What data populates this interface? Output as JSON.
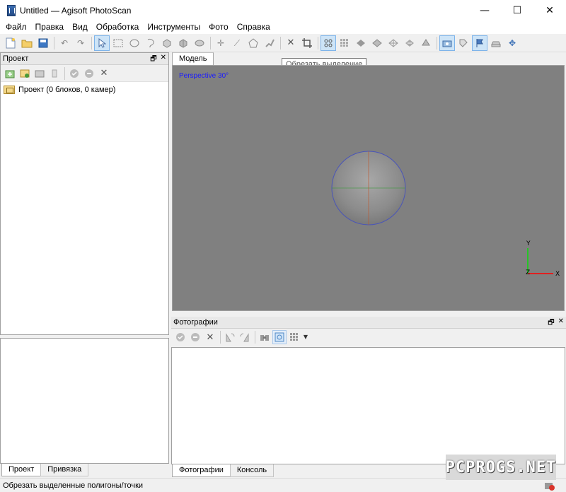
{
  "window": {
    "title": "Untitled — Agisoft PhotoScan",
    "controls": [
      "—",
      "☐",
      "✕"
    ]
  },
  "menu": [
    {
      "label": "Файл"
    },
    {
      "label": "Правка"
    },
    {
      "label": "Вид"
    },
    {
      "label": "Обработка"
    },
    {
      "label": "Инструменты"
    },
    {
      "label": "Фото"
    },
    {
      "label": "Справка"
    }
  ],
  "toolbar": {
    "icons": [
      "new-file",
      "open-folder",
      "save",
      "undo",
      "redo",
      "navigation",
      "rectangle-selection",
      "circle-selection",
      "free-form-selection",
      "resize-region",
      "move-region",
      "rotate-region",
      "ruler-point",
      "ruler",
      "draw-polygon",
      "draw-polyline",
      "delete-selection",
      "crop-selection",
      "point-cloud",
      "dense-cloud",
      "shaded-model",
      "solid-model",
      "wireframe-model",
      "textured-model",
      "tiled-model",
      "show-cameras",
      "show-markers",
      "show-shapes",
      "show-region",
      "reset-view"
    ],
    "active": [
      "navigation",
      "point-cloud",
      "show-cameras",
      "show-shapes"
    ],
    "tooltip": "Обрезать выделение"
  },
  "project_panel": {
    "title": "Проект",
    "tree_root": "Проект (0 блоков, 0 камер)",
    "toolbar_icons": [
      "add-chunk",
      "add-photos",
      "add-folder",
      "remove-item",
      "enable-item",
      "disable-item",
      "delete-item"
    ]
  },
  "left_tabs": [
    {
      "label": "Проект",
      "active": true
    },
    {
      "label": "Привязка",
      "active": false
    }
  ],
  "model_view": {
    "tab": "Модель",
    "overlay": "Perspective 30°",
    "axis_labels": {
      "x": "X",
      "y": "Y",
      "z": "Z"
    },
    "background": "#808080"
  },
  "photos_panel": {
    "title": "Фотографии",
    "toolbar_icons": [
      "enable-camera",
      "disable-camera",
      "remove-camera",
      "rotate-left",
      "rotate-right",
      "filter-by-markers",
      "reset-filter",
      "view-mode",
      "dropdown"
    ]
  },
  "bottom_tabs": [
    {
      "label": "Фотографии",
      "active": true
    },
    {
      "label": "Консоль",
      "active": false
    }
  ],
  "status": "Обрезать выделенные полигоны/точки",
  "watermark": "PCPROGS.NET"
}
